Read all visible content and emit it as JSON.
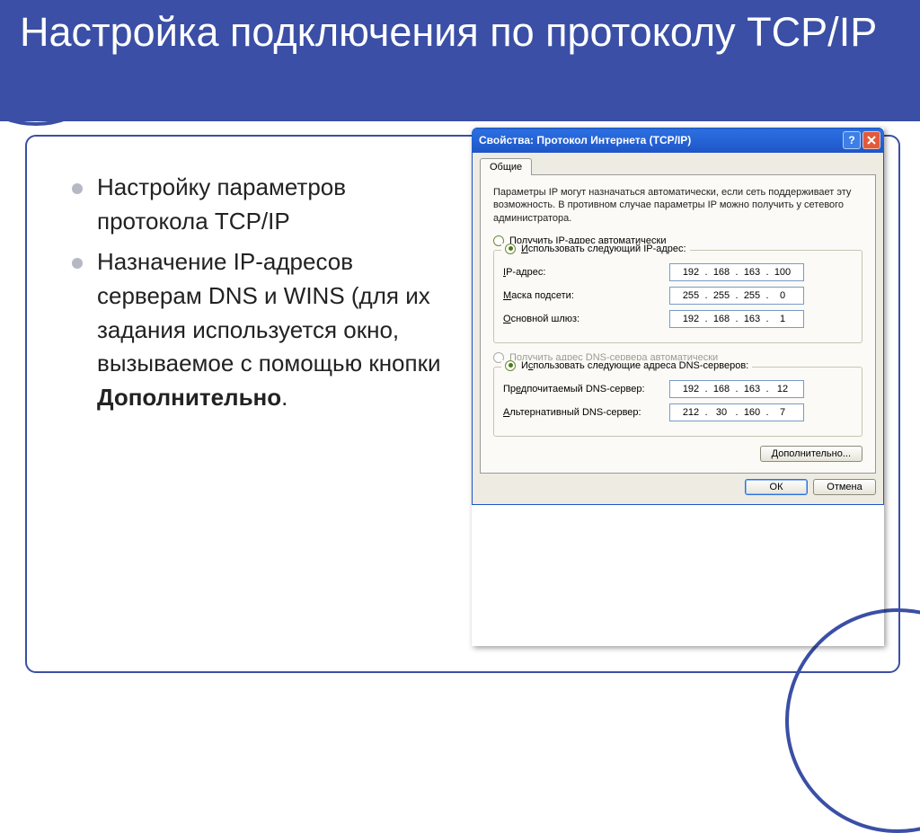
{
  "slide": {
    "title": "Настройка подключения по протоколу TCP/IP",
    "bullets": [
      "Настройку параметров протокола TCP/IP",
      "Назначение IP-адресов серверам DNS и WINS (для их задания используется окно, вызываемое с помощью кнопки "
    ],
    "bullet2_bold": "Дополнительно",
    "bullet2_end": "."
  },
  "dialog": {
    "title": "Свойства: Протокол Интернета (TCP/IP)",
    "tab": "Общие",
    "description": "Параметры IP могут назначаться автоматически, если сеть поддерживает эту возможность. В противном случае параметры IP можно получить у сетевого администратора.",
    "radio_auto_ip": "Получить IP-адрес автоматически",
    "radio_manual_ip": "Использовать следующий IP-адрес:",
    "label_ip": "IP-адрес:",
    "label_mask": "Маска подсети:",
    "label_gateway": "Основной шлюз:",
    "ip": [
      "192",
      "168",
      "163",
      "100"
    ],
    "mask": [
      "255",
      "255",
      "255",
      "0"
    ],
    "gateway": [
      "192",
      "168",
      "163",
      "1"
    ],
    "radio_auto_dns": "Получить адрес DNS-сервера автоматически",
    "radio_manual_dns": "Использовать следующие адреса DNS-серверов:",
    "label_dns1": "Предпочитаемый DNS-сервер:",
    "label_dns2": "Альтернативный DNS-сервер:",
    "dns1": [
      "192",
      "168",
      "163",
      "12"
    ],
    "dns2": [
      "212",
      "30",
      "160",
      "7"
    ],
    "btn_advanced": "Дополнительно...",
    "btn_ok": "ОК",
    "btn_cancel": "Отмена"
  }
}
